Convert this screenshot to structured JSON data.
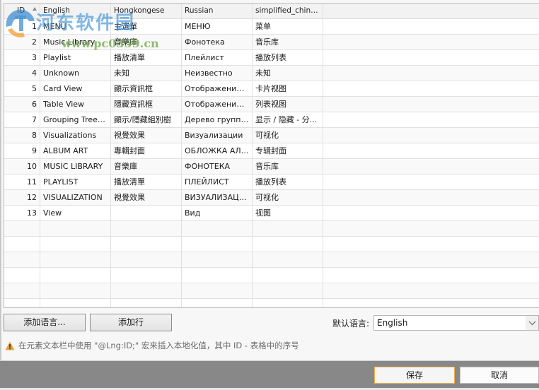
{
  "grid": {
    "headers": {
      "id": "ID",
      "english": "English",
      "hongkongese": "Hongkongese",
      "russian": "Russian",
      "simplified_chinese": "simplified_chinese"
    },
    "sort_indicator": "ascending",
    "rows": [
      {
        "id": "1",
        "english": "MENU",
        "hongkongese": "主選單",
        "russian": "МЕНЮ",
        "simplified_chinese": "菜单"
      },
      {
        "id": "2",
        "english": "Music Library",
        "hongkongese": "音樂庫",
        "russian": "Фонотека",
        "simplified_chinese": "音乐库"
      },
      {
        "id": "3",
        "english": "Playlist",
        "hongkongese": "播放清單",
        "russian": "Плейлист",
        "simplified_chinese": "播放列表"
      },
      {
        "id": "4",
        "english": "Unknown",
        "hongkongese": "未知",
        "russian": "Неизвестно",
        "simplified_chinese": "未知"
      },
      {
        "id": "5",
        "english": "Card View",
        "hongkongese": "顯示資訊框",
        "russian": "Отображение ...",
        "simplified_chinese": "卡片视图"
      },
      {
        "id": "6",
        "english": "Table View",
        "hongkongese": "隱藏資訊框",
        "russian": "Отображение ...",
        "simplified_chinese": "列表视图"
      },
      {
        "id": "7",
        "english": "Grouping Tree - ...",
        "hongkongese": "顯示/隱藏組別樹",
        "russian": "Дерево группи...",
        "simplified_chinese": "显示 / 隐藏 - 分..."
      },
      {
        "id": "8",
        "english": "Visualizations",
        "hongkongese": "視覺效果",
        "russian": "Визуализации",
        "simplified_chinese": "可视化"
      },
      {
        "id": "9",
        "english": "ALBUM ART",
        "hongkongese": "專輯封面",
        "russian": "ОБЛОЖКА АЛЬБ...",
        "simplified_chinese": "专辑封面"
      },
      {
        "id": "10",
        "english": "MUSIC LIBRARY",
        "hongkongese": "音樂庫",
        "russian": "ФОНОТЕКА",
        "simplified_chinese": "音乐库"
      },
      {
        "id": "11",
        "english": "PLAYLIST",
        "hongkongese": "播放清單",
        "russian": "ПЛЕЙЛИСТ",
        "simplified_chinese": "播放列表"
      },
      {
        "id": "12",
        "english": "VISUALIZATION",
        "hongkongese": "視覺效果",
        "russian": "ВИЗУАЛИЗАЦИЯ",
        "simplified_chinese": "可视化"
      },
      {
        "id": "13",
        "english": "View",
        "hongkongese": "",
        "russian": "Вид",
        "simplified_chinese": "视图"
      }
    ],
    "empty_rows": 6
  },
  "buttons": {
    "add_language": "添加语言...",
    "add_row": "添加行"
  },
  "default_language": {
    "label": "默认语言:",
    "value": "English"
  },
  "hint": {
    "icon": "warning-icon",
    "text": "在元素文本栏中使用 \"@Lng:ID;\" 宏来插入本地化值，其中 ID - 表格中的序号"
  },
  "footer": {
    "save": "保存",
    "cancel": "取消"
  },
  "watermark": {
    "title": "河东软件园",
    "url": "www.pc0359.cn"
  },
  "colors": {
    "footer_bg": "#888888",
    "save_border": "#f2b24a",
    "warning": "#e8a23a"
  }
}
